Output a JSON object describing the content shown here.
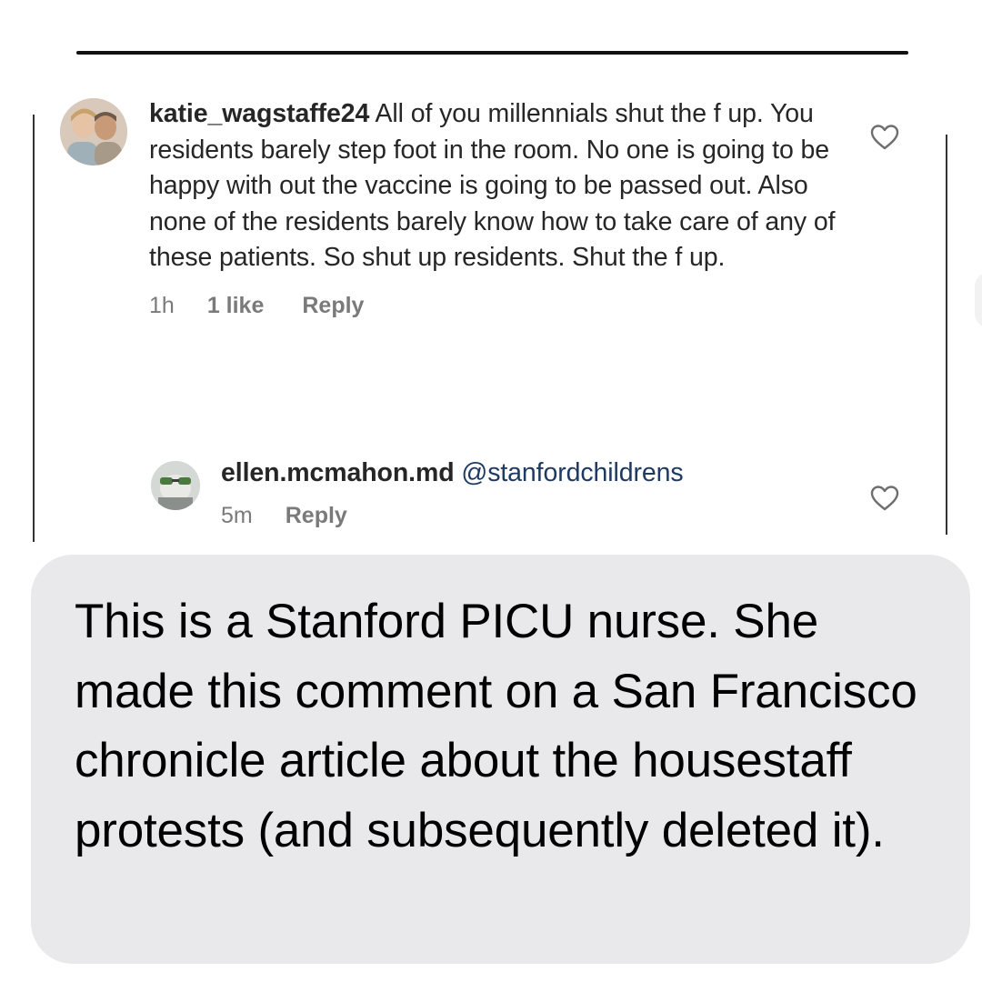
{
  "post_comment": {
    "username": "katie_wagstaffe24",
    "text": "All of you millennials shut the f up. You residents barely step foot in the room. No one is going to be happy with out the vaccine is going to be passed out. Also none of the residents barely know how to take care of any of these patients. So shut up residents. Shut the f up.",
    "time": "1h",
    "likes": "1 like",
    "reply_label": "Reply",
    "like_icon": "heart-outline-icon"
  },
  "reply_comment": {
    "username": "ellen.mcmahon.md",
    "mention": "@stanfordchildrens",
    "time": "5m",
    "reply_label": "Reply",
    "like_icon": "heart-outline-icon"
  },
  "message_bubble": {
    "text": "This is a Stanford PICU nurse. She made this comment on a San Francisco chronicle article about the housestaff protests (and subsequently deleted it)."
  },
  "colors": {
    "bubble_background": "#e9e9eb",
    "mention_link": "#1f3a62",
    "meta_text": "#7a7a7a"
  }
}
